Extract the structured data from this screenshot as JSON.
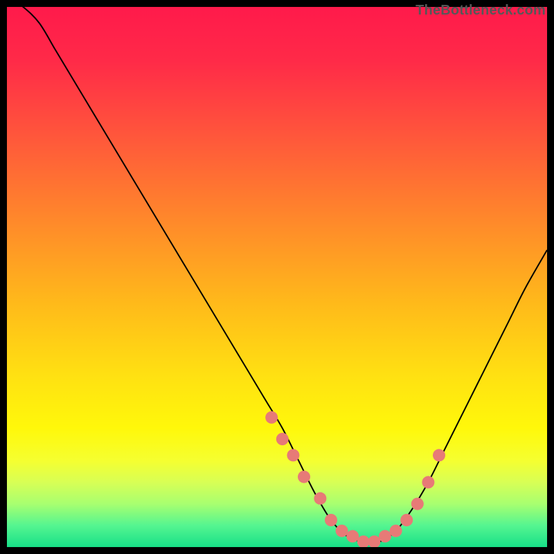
{
  "attribution": "TheBottleneck.com",
  "chart_data": {
    "type": "line",
    "title": "",
    "xlabel": "",
    "ylabel": "",
    "ylim": [
      0,
      100
    ],
    "xlim": [
      0,
      100
    ],
    "series": [
      {
        "name": "bottleneck-curve",
        "x": [
          0,
          3,
          6,
          9,
          12,
          15,
          18,
          21,
          24,
          27,
          30,
          33,
          36,
          39,
          42,
          45,
          48,
          51,
          54,
          57,
          60,
          63,
          66,
          69,
          72,
          75,
          78,
          81,
          84,
          87,
          90,
          93,
          96,
          100
        ],
        "values": [
          102,
          100,
          97,
          92,
          87,
          82,
          77,
          72,
          67,
          62,
          57,
          52,
          47,
          42,
          37,
          32,
          27,
          22,
          16,
          10,
          5,
          2,
          1,
          1,
          3,
          7,
          12,
          18,
          24,
          30,
          36,
          42,
          48,
          55
        ]
      }
    ],
    "markers": {
      "name": "curve-markers",
      "x": [
        49,
        51,
        53,
        55,
        58,
        60,
        62,
        64,
        66,
        68,
        70,
        72,
        74,
        76,
        78,
        80
      ],
      "values": [
        24,
        20,
        17,
        13,
        9,
        5,
        3,
        2,
        1,
        1,
        2,
        3,
        5,
        8,
        12,
        17
      ]
    },
    "gradient_stops": [
      {
        "offset": 0.0,
        "color": "#ff1a4b"
      },
      {
        "offset": 0.1,
        "color": "#ff2a48"
      },
      {
        "offset": 0.25,
        "color": "#ff5a3a"
      },
      {
        "offset": 0.4,
        "color": "#ff8a2a"
      },
      {
        "offset": 0.55,
        "color": "#ffba1a"
      },
      {
        "offset": 0.68,
        "color": "#ffe012"
      },
      {
        "offset": 0.78,
        "color": "#fff80a"
      },
      {
        "offset": 0.84,
        "color": "#f5ff30"
      },
      {
        "offset": 0.88,
        "color": "#d8ff55"
      },
      {
        "offset": 0.92,
        "color": "#a8ff70"
      },
      {
        "offset": 0.96,
        "color": "#55f590"
      },
      {
        "offset": 1.0,
        "color": "#17e088"
      }
    ]
  }
}
